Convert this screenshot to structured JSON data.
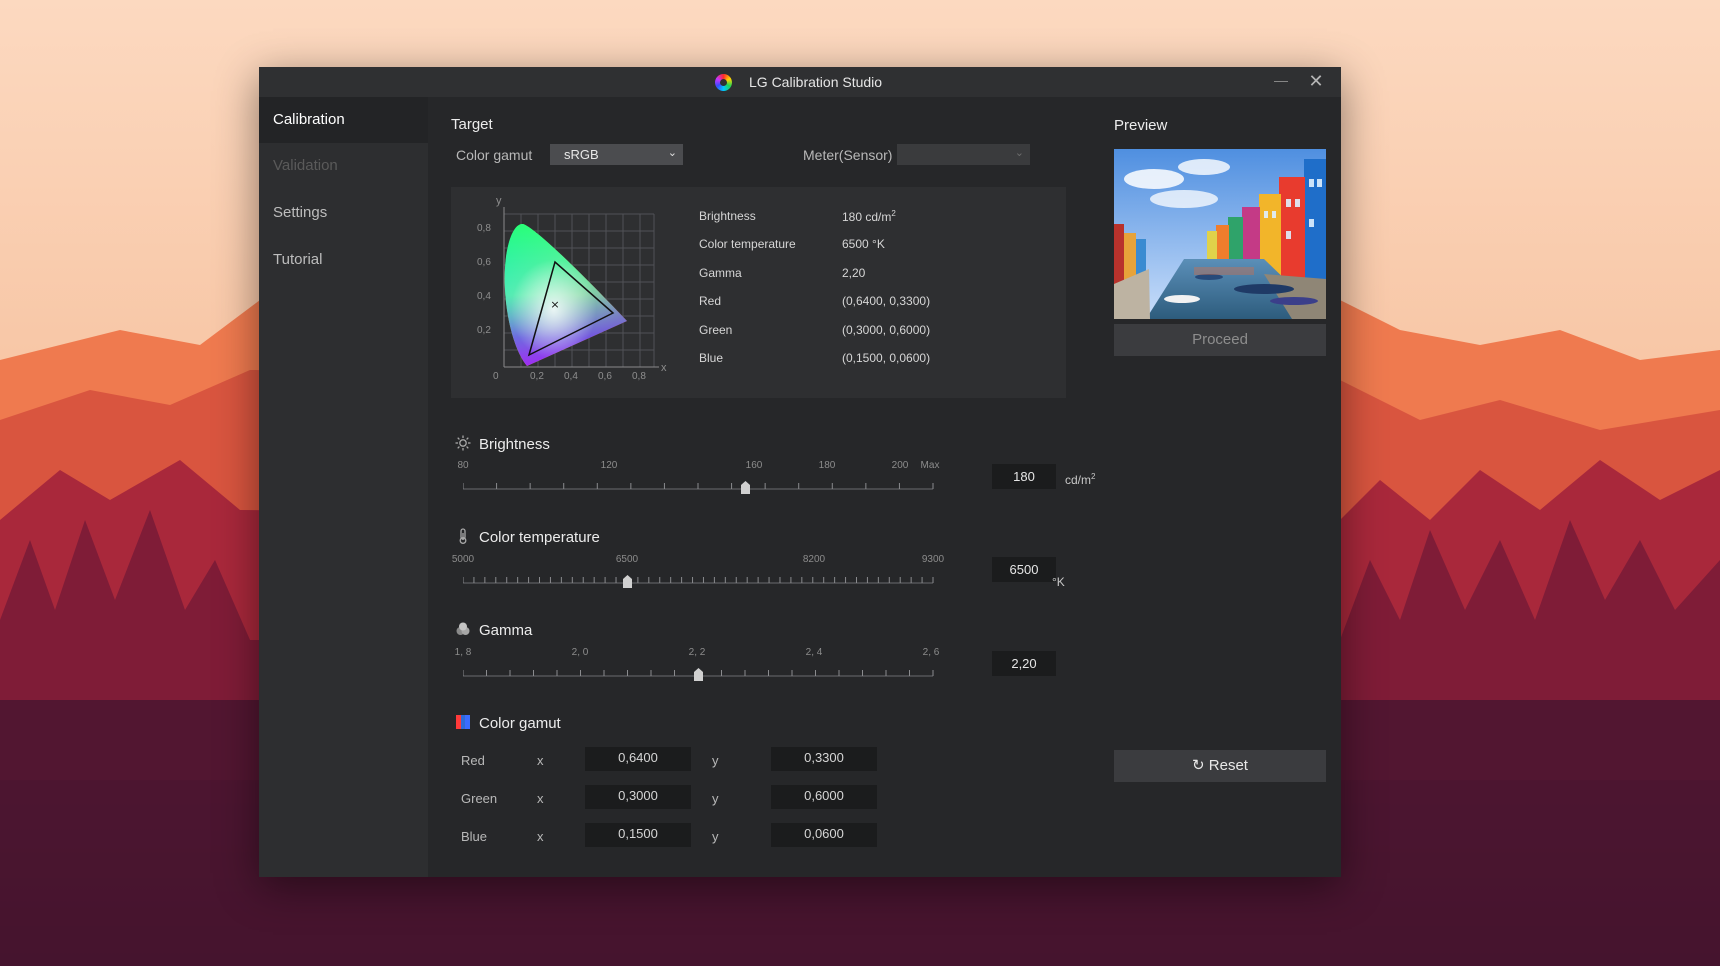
{
  "window": {
    "title": "LG Calibration Studio"
  },
  "sidebar": {
    "items": [
      {
        "label": "Calibration",
        "state": "active"
      },
      {
        "label": "Validation",
        "state": "disabled"
      },
      {
        "label": "Settings",
        "state": "normal"
      },
      {
        "label": "Tutorial",
        "state": "normal"
      }
    ]
  },
  "target": {
    "heading": "Target",
    "gamut_label": "Color gamut",
    "gamut_value": "sRGB",
    "meter_label": "Meter(Sensor)",
    "meter_value": "",
    "chart": {
      "y_axis": "y",
      "x_axis": "x",
      "y_ticks": [
        "0,8",
        "0,6",
        "0,4",
        "0,2"
      ],
      "x_ticks": [
        "0",
        "0,2",
        "0,4",
        "0,6",
        "0,8"
      ]
    },
    "rows": [
      {
        "label": "Brightness",
        "value": "180 cd/m",
        "sup": "2"
      },
      {
        "label": "Color temperature",
        "value": "6500 °K",
        "sup": ""
      },
      {
        "label": "Gamma",
        "value": "2,20",
        "sup": ""
      },
      {
        "label": "Red",
        "value": "(0,6400, 0,3300)",
        "sup": ""
      },
      {
        "label": "Green",
        "value": "(0,3000, 0,6000)",
        "sup": ""
      },
      {
        "label": "Blue",
        "value": "(0,1500, 0,0600)",
        "sup": ""
      }
    ]
  },
  "brightness": {
    "heading": "Brightness",
    "ticks": [
      "80",
      "120",
      "160",
      "180",
      "200",
      "Max"
    ],
    "value": "180",
    "unit": "cd/m",
    "unit_sup": "2",
    "level": 0.6
  },
  "color_temperature": {
    "heading": "Color temperature",
    "ticks": [
      "5000",
      "6500",
      "8200",
      "9300"
    ],
    "value": "6500",
    "unit": "°K",
    "level": 0.349
  },
  "gamma": {
    "heading": "Gamma",
    "ticks": [
      "1, 8",
      "2, 0",
      "2, 2",
      "2, 4",
      "2, 6"
    ],
    "value": "2,20",
    "level": 0.5
  },
  "color_gamut": {
    "heading": "Color gamut",
    "x_label": "x",
    "y_label": "y",
    "rows": [
      {
        "label": "Red",
        "x": "0,6400",
        "y": "0,3300"
      },
      {
        "label": "Green",
        "x": "0,3000",
        "y": "0,6000"
      },
      {
        "label": "Blue",
        "x": "0,1500",
        "y": "0,0600"
      }
    ]
  },
  "preview": {
    "heading": "Preview",
    "proceed_label": "Proceed",
    "reset_label": "Reset"
  },
  "colors": {
    "window_bg": "#262729",
    "sidebar_bg": "#2d2e30",
    "field_bg": "#1b1c1d",
    "accent_select": "#4b4c4f"
  }
}
